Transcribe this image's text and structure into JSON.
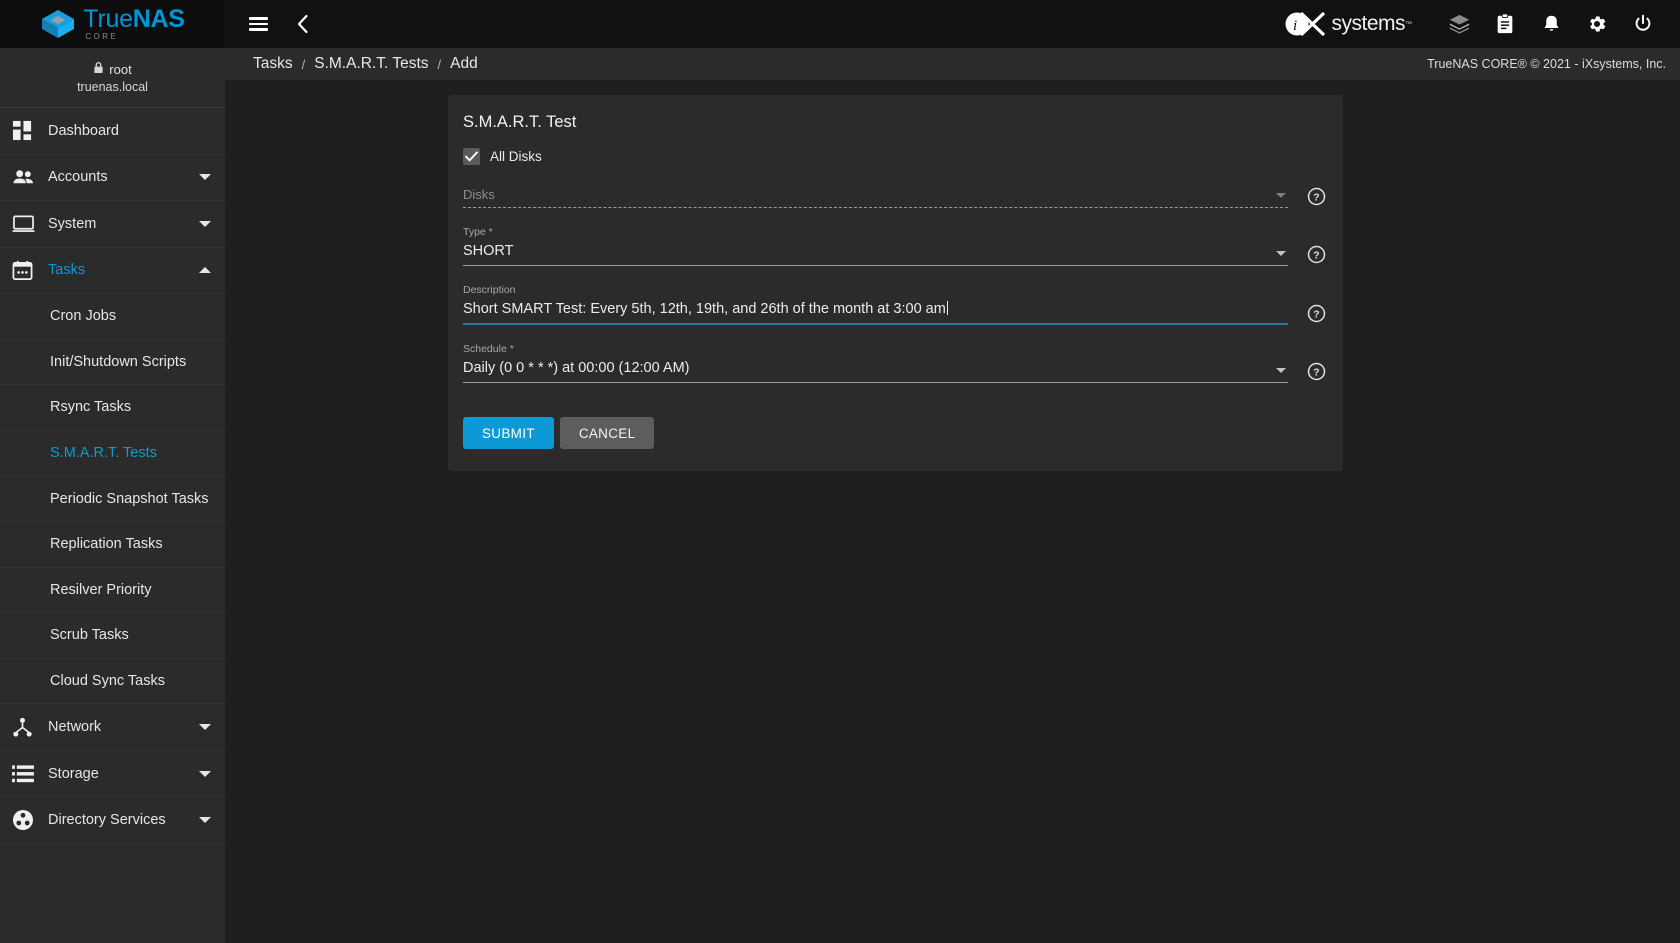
{
  "brand": {
    "logo_main_prefix": "True",
    "logo_main_suffix": "NAS",
    "logo_sub": "CORE",
    "vendor": "systems",
    "vendor_tm": "™"
  },
  "topbar": {
    "menu_icon": "hamburger-icon",
    "back_icon": "chevron-left-icon",
    "icons": [
      {
        "name": "jobs-cube-icon",
        "glyph": "cube"
      },
      {
        "name": "tasks-clipboard-icon",
        "glyph": "clipboard"
      },
      {
        "name": "alerts-bell-icon",
        "glyph": "bell"
      },
      {
        "name": "settings-gear-icon",
        "glyph": "gear"
      },
      {
        "name": "power-icon",
        "glyph": "power"
      }
    ]
  },
  "breadcrumb": {
    "items": [
      "Tasks",
      "S.M.A.R.T. Tests",
      "Add"
    ],
    "separator": "/",
    "copyright": "TrueNAS CORE® © 2021 - iXsystems, Inc."
  },
  "sidebar": {
    "user": {
      "lock_icon": "lock-icon",
      "name": "root",
      "host": "truenas.local"
    },
    "items": [
      {
        "label": "Dashboard",
        "icon": "dashboard-icon",
        "expandable": false,
        "active": false
      },
      {
        "label": "Accounts",
        "icon": "accounts-people-icon",
        "expandable": true,
        "expanded": false,
        "active": false
      },
      {
        "label": "System",
        "icon": "system-monitor-icon",
        "expandable": true,
        "expanded": false,
        "active": false
      },
      {
        "label": "Tasks",
        "icon": "tasks-calendar-icon",
        "expandable": true,
        "expanded": true,
        "active": true
      }
    ],
    "sub_items": [
      {
        "label": "Cron Jobs",
        "active": false
      },
      {
        "label": "Init/Shutdown Scripts",
        "active": false
      },
      {
        "label": "Rsync Tasks",
        "active": false
      },
      {
        "label": "S.M.A.R.T. Tests",
        "active": true
      },
      {
        "label": "Periodic Snapshot Tasks",
        "active": false
      },
      {
        "label": "Replication Tasks",
        "active": false
      },
      {
        "label": "Resilver Priority",
        "active": false
      },
      {
        "label": "Scrub Tasks",
        "active": false
      },
      {
        "label": "Cloud Sync Tasks",
        "active": false
      }
    ],
    "items_after": [
      {
        "label": "Network",
        "icon": "network-icon",
        "expandable": true,
        "active": false
      },
      {
        "label": "Storage",
        "icon": "storage-list-icon",
        "expandable": true,
        "active": false
      },
      {
        "label": "Directory Services",
        "icon": "directory-services-icon",
        "expandable": true,
        "active": false
      }
    ]
  },
  "form": {
    "title": "S.M.A.R.T. Test",
    "all_disks": {
      "label": "All Disks",
      "checked": true,
      "icon": "checkmark-icon"
    },
    "disks": {
      "label": "Disks",
      "value": "",
      "disabled": true,
      "arrow_icon": "chevron-down-icon",
      "help_icon": "help-circle-icon"
    },
    "type": {
      "label": "Type *",
      "value": "SHORT",
      "arrow_icon": "chevron-down-icon",
      "help_icon": "help-circle-icon"
    },
    "description": {
      "label": "Description",
      "value": "Short SMART Test: Every 5th, 12th, 19th, and 26th of the month at 3:00 am",
      "focused": true,
      "help_icon": "help-circle-icon"
    },
    "schedule": {
      "label": "Schedule *",
      "value": "Daily (0 0 * * *) at 00:00 (12:00 AM)",
      "arrow_icon": "chevron-down-icon",
      "help_icon": "help-circle-icon"
    },
    "submit_label": "SUBMIT",
    "cancel_label": "CANCEL"
  },
  "colors": {
    "accent": "#0d99d6",
    "brand_blue": "#0095d5",
    "topbar_bg": "#111111",
    "sidebar_bg": "#2b2b2b",
    "content_bg": "#1f1f1f",
    "card_bg": "#2b2b2b",
    "focus_underline": "#2d7596"
  }
}
